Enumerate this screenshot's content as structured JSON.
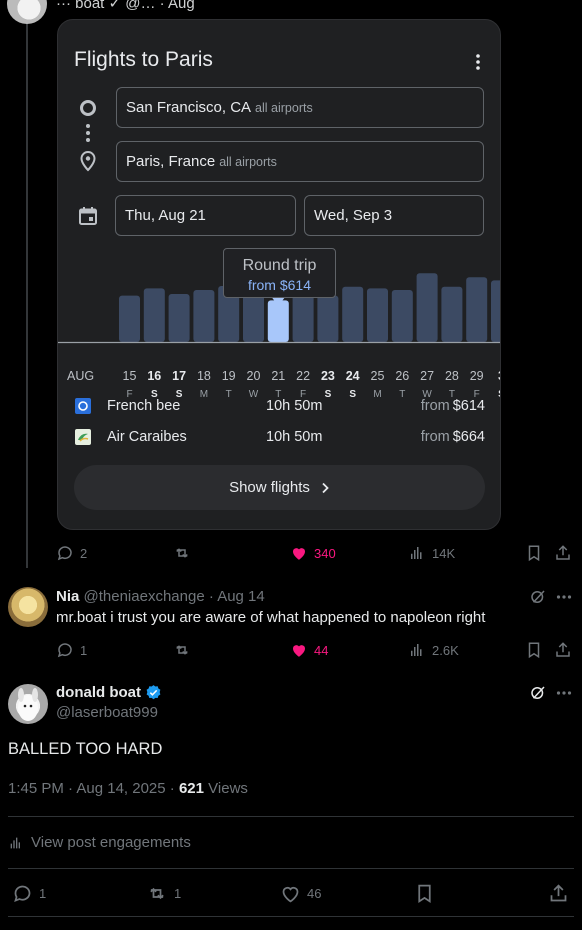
{
  "top_post": {
    "header_fragment": "··· boat ✓ @… · Aug"
  },
  "flights_card": {
    "title": "Flights to Paris",
    "origin": {
      "value": "San Francisco, CA",
      "suffix": "all airports"
    },
    "destination": {
      "value": "Paris, France",
      "suffix": "all airports"
    },
    "depart_date": "Thu, Aug 21",
    "return_date": "Wed, Sep 3",
    "tooltip": {
      "title": "Round trip",
      "price": "from $614"
    },
    "month_label": "AUG",
    "days": [
      {
        "num": "15",
        "dow": "F",
        "bold": false,
        "bar": 0.58,
        "selected": false
      },
      {
        "num": "16",
        "dow": "S",
        "bold": true,
        "bar": 0.67,
        "selected": false
      },
      {
        "num": "17",
        "dow": "S",
        "bold": true,
        "bar": 0.6,
        "selected": false
      },
      {
        "num": "18",
        "dow": "M",
        "bold": false,
        "bar": 0.65,
        "selected": false
      },
      {
        "num": "19",
        "dow": "T",
        "bold": false,
        "bar": 0.7,
        "selected": false
      },
      {
        "num": "20",
        "dow": "W",
        "bold": false,
        "bar": 0.62,
        "selected": false
      },
      {
        "num": "21",
        "dow": "T",
        "bold": false,
        "bar": 0.52,
        "selected": true
      },
      {
        "num": "22",
        "dow": "F",
        "bold": false,
        "bar": 0.6,
        "selected": false
      },
      {
        "num": "23",
        "dow": "S",
        "bold": true,
        "bar": 0.58,
        "selected": false
      },
      {
        "num": "24",
        "dow": "S",
        "bold": true,
        "bar": 0.69,
        "selected": false
      },
      {
        "num": "25",
        "dow": "M",
        "bold": false,
        "bar": 0.67,
        "selected": false
      },
      {
        "num": "26",
        "dow": "T",
        "bold": false,
        "bar": 0.65,
        "selected": false
      },
      {
        "num": "27",
        "dow": "W",
        "bold": false,
        "bar": 0.86,
        "selected": false
      },
      {
        "num": "28",
        "dow": "T",
        "bold": false,
        "bar": 0.69,
        "selected": false
      },
      {
        "num": "29",
        "dow": "F",
        "bold": false,
        "bar": 0.81,
        "selected": false
      },
      {
        "num": "3",
        "dow": "S",
        "bold": true,
        "bar": 0.77,
        "selected": false
      }
    ],
    "airlines": [
      {
        "name": "French bee",
        "duration": "10h 50m",
        "from": "from",
        "price": "$614",
        "logo_color": "#2a6fdb"
      },
      {
        "name": "Air Caraibes",
        "duration": "10h 50m",
        "from": "from",
        "price": "$664",
        "logo_color": "#e6efe0"
      }
    ],
    "show_flights_label": "Show flights"
  },
  "top_post_actions": {
    "replies": "2",
    "reposts": "",
    "likes": "340",
    "views": "14K"
  },
  "reply": {
    "name": "Nia",
    "handle": "@theniaexchange",
    "sep": "·",
    "date": "Aug 14",
    "text": "mr.boat i trust you are aware of what happened to napoleon right",
    "actions": {
      "replies": "1",
      "reposts": "",
      "likes": "44",
      "views": "2.6K"
    }
  },
  "main_post": {
    "name": "donald boat",
    "handle": "@laserboat999",
    "text": "BALLED TOO HARD",
    "timestamp": "1:45 PM · Aug 14, 2025 ·",
    "views_count": "621",
    "views_label": "Views",
    "engagements_label": "View post engagements",
    "actions": {
      "replies": "1",
      "reposts": "1",
      "likes": "46"
    }
  },
  "colors": {
    "like": "#f91880",
    "verified": "#1d9bf0",
    "selected_bar": "#a8c7fa",
    "bar": "#3c4a63"
  }
}
